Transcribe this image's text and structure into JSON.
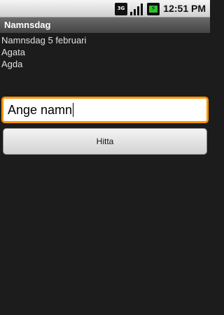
{
  "status_bar": {
    "network_badge": "3G",
    "time": "12:51 PM",
    "icons": [
      "3g-icon",
      "signal-icon",
      "battery-charging-icon"
    ]
  },
  "app": {
    "title": "Namnsdag"
  },
  "content": {
    "lines": [
      "Namnsdag 5 februari",
      "Agata",
      "Agda"
    ]
  },
  "form": {
    "name_input_value": "Ange namn",
    "button_label": "Hitta"
  },
  "colors": {
    "focus_border": "#ff9400",
    "background": "#1c1c1c",
    "battery": "#34c034"
  }
}
